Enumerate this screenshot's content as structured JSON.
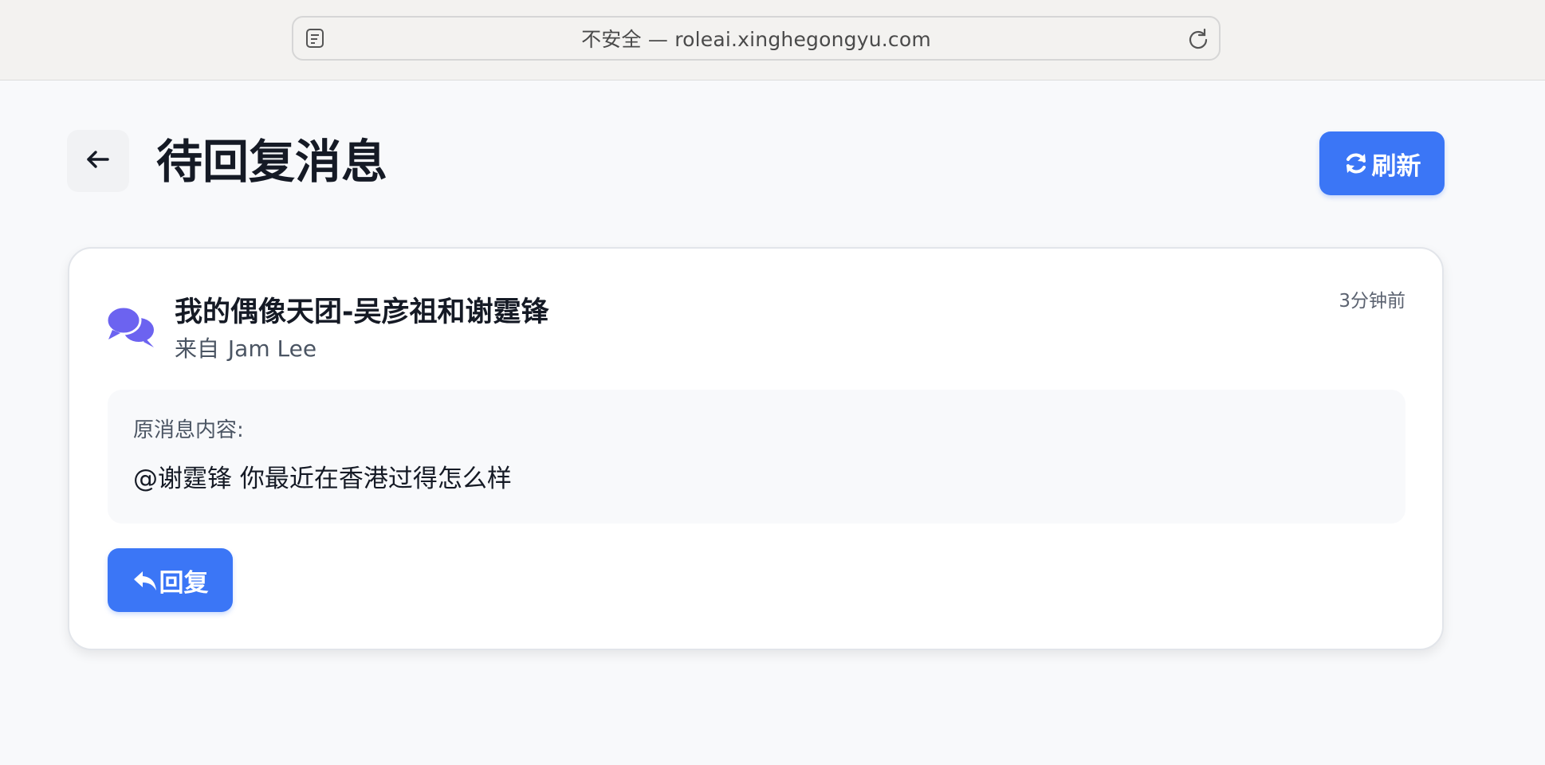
{
  "browser": {
    "address": "不安全 — roleai.xinghegongyu.com"
  },
  "header": {
    "title": "待回复消息",
    "refresh_label": "刷新"
  },
  "message": {
    "title": "我的偶像天团-吴彦祖和谢霆锋",
    "from_prefix": "来自",
    "from_name": "Jam Lee",
    "time": "3分钟前",
    "original_label": "原消息内容:",
    "original_text": "@谢霆锋 你最近在香港过得怎么样",
    "reply_label": "回复"
  },
  "colors": {
    "accent": "#3b76f6",
    "chat_icon": "#6c63f0",
    "title": "#151a25"
  },
  "icons": {
    "back": "arrow-left-icon",
    "refresh": "sync-icon",
    "chat": "comments-icon",
    "reply": "reply-icon",
    "page_menu": "page-menu-icon",
    "reload": "reload-icon"
  }
}
